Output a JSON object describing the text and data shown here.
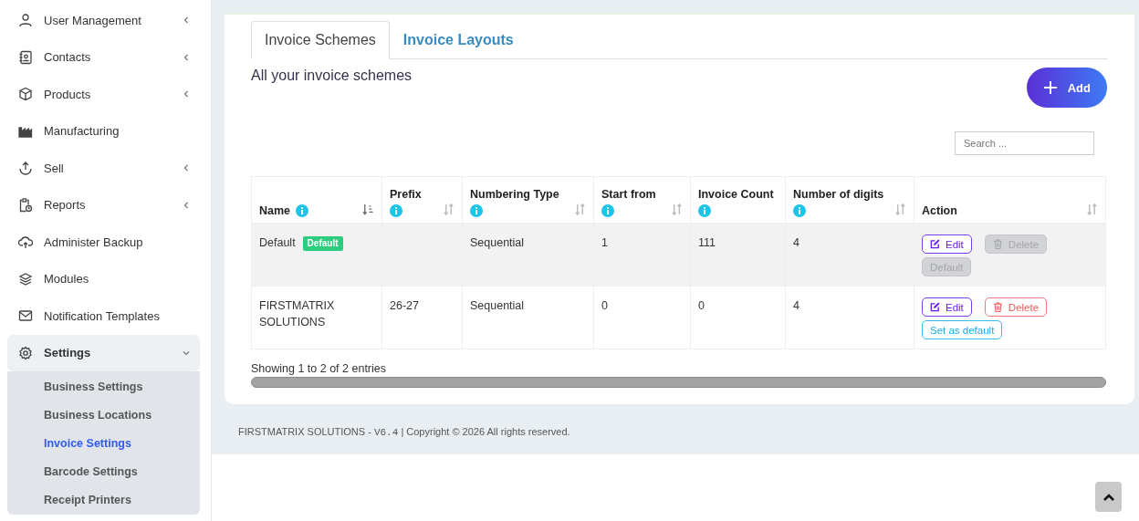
{
  "sidebar": {
    "items": [
      {
        "label": "User Management",
        "expandable": true,
        "expanded": false
      },
      {
        "label": "Contacts",
        "expandable": true,
        "expanded": false
      },
      {
        "label": "Products",
        "expandable": true,
        "expanded": false
      },
      {
        "label": "Manufacturing",
        "expandable": false,
        "expanded": false
      },
      {
        "label": "Sell",
        "expandable": true,
        "expanded": false
      },
      {
        "label": "Reports",
        "expandable": true,
        "expanded": false
      },
      {
        "label": "Administer Backup",
        "expandable": false,
        "expanded": false
      },
      {
        "label": "Modules",
        "expandable": false,
        "expanded": false
      },
      {
        "label": "Notification Templates",
        "expandable": false,
        "expanded": false
      },
      {
        "label": "Settings",
        "expandable": true,
        "expanded": true,
        "children": [
          {
            "label": "Business Settings",
            "selected": false
          },
          {
            "label": "Business Locations",
            "selected": false
          },
          {
            "label": "Invoice Settings",
            "selected": true
          },
          {
            "label": "Barcode Settings",
            "selected": false
          },
          {
            "label": "Receipt Printers",
            "selected": false
          }
        ]
      }
    ]
  },
  "tabs": [
    {
      "label": "Invoice Schemes",
      "selected": true
    },
    {
      "label": "Invoice Layouts",
      "selected": false
    }
  ],
  "heading": "All your invoice schemes",
  "add_button": {
    "label": "Add"
  },
  "search": {
    "placeholder": "Search ..."
  },
  "table": {
    "columns": [
      {
        "label": "Name",
        "info": true,
        "sortable": true,
        "sorted": true
      },
      {
        "label": "Prefix",
        "info": true,
        "sortable": true,
        "sorted": false
      },
      {
        "label": "Numbering Type",
        "info": true,
        "sortable": true,
        "sorted": false
      },
      {
        "label": "Start from",
        "info": true,
        "sortable": true,
        "sorted": false
      },
      {
        "label": "Invoice Count",
        "info": true,
        "sortable": false,
        "sorted": false
      },
      {
        "label": "Number of digits",
        "info": true,
        "sortable": true,
        "sorted": false
      },
      {
        "label": "Action",
        "info": false,
        "sortable": true,
        "sorted": false
      }
    ],
    "rows": [
      {
        "hovered": true,
        "name": "Default",
        "badge": "Default",
        "prefix": "",
        "numbering": "Sequential",
        "start": "1",
        "count": "111",
        "digits": "4",
        "actions": [
          {
            "kind": "edit",
            "label": "Edit",
            "disabled": false
          },
          {
            "kind": "delete",
            "label": "Delete",
            "disabled": true
          },
          {
            "kind": "default",
            "label": "Default",
            "disabled": true
          }
        ]
      },
      {
        "hovered": false,
        "name": "FIRSTMATRIX SOLUTIONS",
        "prefix": "26-27",
        "numbering": "Sequential",
        "start": "0",
        "count": "0",
        "digits": "4",
        "actions": [
          {
            "kind": "edit",
            "label": "Edit",
            "disabled": false
          },
          {
            "kind": "delete",
            "label": "Delete",
            "disabled": false
          },
          {
            "kind": "default",
            "label": "Set as default",
            "disabled": false
          }
        ]
      }
    ]
  },
  "entries_info": "Showing 1 to 2 of 2 entries",
  "footer": {
    "prefix": "FIRSTMATRIX SOLUTIONS - ",
    "version": "V6.4",
    "suffix": " | Copyright © 2026 All rights reserved."
  }
}
